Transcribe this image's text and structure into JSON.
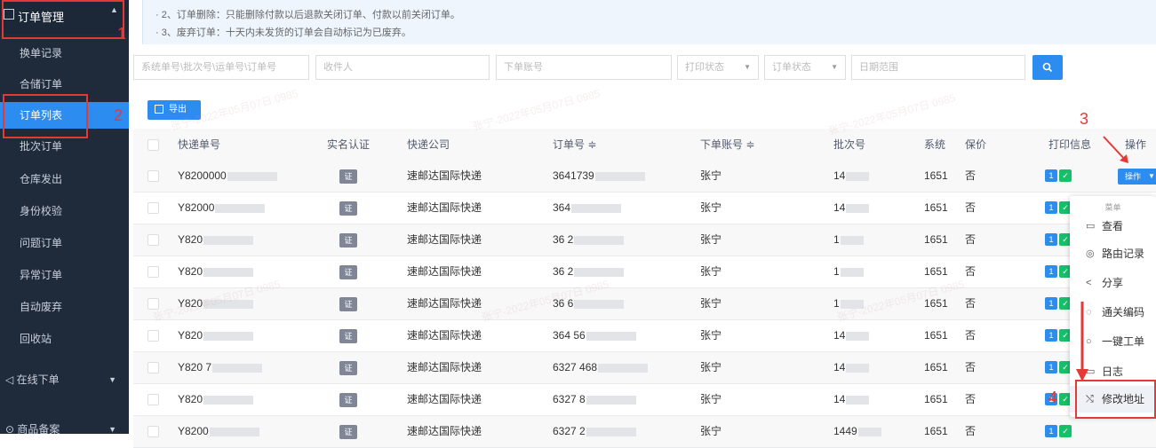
{
  "sidebar": {
    "header": "订单管理",
    "items": [
      {
        "label": "换单记录",
        "active": false
      },
      {
        "label": "合储订单",
        "active": false
      },
      {
        "label": "订单列表",
        "active": true
      },
      {
        "label": "批次订单",
        "active": false
      },
      {
        "label": "仓库发出",
        "active": false
      },
      {
        "label": "身份校验",
        "active": false
      },
      {
        "label": "问题订单",
        "active": false
      },
      {
        "label": "异常订单",
        "active": false
      },
      {
        "label": "自动废弃",
        "active": false
      },
      {
        "label": "回收站",
        "active": false
      }
    ],
    "groups": [
      {
        "label": "在线下单"
      },
      {
        "label": "商品备案"
      }
    ]
  },
  "notice": {
    "line1": "· 2、订单删除：只能删除付款以后退款关闭订单、付款以前关闭订单。",
    "line2": "· 3、废弃订单：十天内未发货的订单会自动标记为已废弃。"
  },
  "filters": {
    "order_no_placeholder": "系统单号\\批次号\\运单号\\订单号",
    "receiver_placeholder": "收件人",
    "account_placeholder": "下单账号",
    "print_status": "打印状态",
    "order_status": "订单状态",
    "date_range": "日期范围"
  },
  "toolbar": {
    "export_label": "导出"
  },
  "table": {
    "headers": {
      "tracking_no": "快递单号",
      "real_name": "实名认证",
      "courier": "快递公司",
      "order_no": "订单号 ≑",
      "account": "下单账号 ≑",
      "batch_no": "批次号",
      "system_no": "系统",
      "insured": "保价",
      "print_info": "打印信息",
      "actions": "操作"
    },
    "rows": [
      {
        "tracking": "Y8200000",
        "cert": "证",
        "courier": "速邮达国际快递",
        "order": "3641739",
        "account": "张宁",
        "batch": "14",
        "system": "1651",
        "insured": "否"
      },
      {
        "tracking": "Y82000",
        "cert": "证",
        "courier": "速邮达国际快递",
        "order": "364",
        "account": "张宁",
        "batch": "14",
        "system": "1651",
        "insured": "否"
      },
      {
        "tracking": "Y820",
        "cert": "证",
        "courier": "速邮达国际快递",
        "order": "36  2",
        "account": "张宁",
        "batch": "1",
        "system": "1651",
        "insured": "否"
      },
      {
        "tracking": "Y820",
        "cert": "证",
        "courier": "速邮达国际快递",
        "order": "36  2",
        "account": "张宁",
        "batch": "1",
        "system": "1651",
        "insured": "否"
      },
      {
        "tracking": "Y820",
        "cert": "证",
        "courier": "速邮达国际快递",
        "order": "36  6",
        "account": "张宁",
        "batch": "1",
        "system": "1651",
        "insured": "否"
      },
      {
        "tracking": "Y820",
        "cert": "证",
        "courier": "速邮达国际快递",
        "order": "364  56",
        "account": "张宁",
        "batch": "14",
        "system": "1651",
        "insured": "否"
      },
      {
        "tracking": "Y820  7",
        "cert": "证",
        "courier": "速邮达国际快递",
        "order": "6327  468",
        "account": "张宁",
        "batch": "14",
        "system": "1651",
        "insured": "否"
      },
      {
        "tracking": "Y820",
        "cert": "证",
        "courier": "速邮达国际快递",
        "order": "6327  8",
        "account": "张宁",
        "batch": "14",
        "system": "1651",
        "insured": "否"
      },
      {
        "tracking": "Y8200",
        "cert": "证",
        "courier": "速邮达国际快递",
        "order": "6327  2",
        "account": "张宁",
        "batch": "1449",
        "system": "1651",
        "insured": "否"
      }
    ],
    "print_badge": "1",
    "action_button": "操作"
  },
  "dropdown": {
    "title": "菜单",
    "items": [
      {
        "icon": "▭",
        "label": "查看"
      },
      {
        "icon": "◎",
        "label": "路由记录"
      },
      {
        "icon": "<",
        "label": "分享"
      },
      {
        "icon": "◌",
        "label": "通关编码"
      },
      {
        "icon": "○",
        "label": "一键工单"
      },
      {
        "icon": "▭",
        "label": "日志"
      },
      {
        "icon": "⤭",
        "label": "修改地址"
      }
    ]
  },
  "annotations": [
    "1",
    "2",
    "3",
    "4"
  ],
  "watermark": "张宁-2022年05月07日 0985",
  "colors": {
    "sidebar": "#1f2a3a",
    "accent": "#2d8cf0",
    "annotation": "#e53935",
    "success": "#19be6b"
  }
}
